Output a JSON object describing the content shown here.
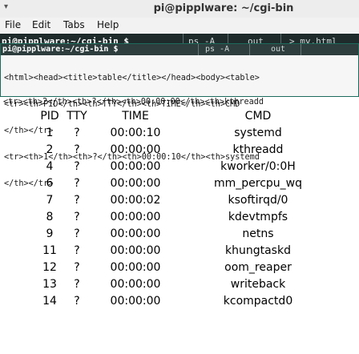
{
  "window": {
    "menu_glyph": "▾",
    "title": "pi@pipplware: ~/cgi-bin"
  },
  "menubar": {
    "file": "File",
    "edit": "Edit",
    "tabs": "Tabs",
    "help": "Help"
  },
  "back_tabbar": {
    "host": "pi@pipplware:~/cgi-bin $",
    "prompt_char": "$",
    "ps": "ps -A",
    "out": "out",
    "redirect": "> my.html"
  },
  "front_terminal": {
    "host": "pi@pipplware:~/cgi-bin $",
    "ps": "ps -A",
    "out": "out",
    "lines": [
      "<html><head><title>table</title></head><body><table>",
      "<tr><th>PID</th><th>TTY</th><th>TIME</th><th>CMD",
      "</th></tr>",
      "<tr><th>1</th><th>?</th><th>00:00:10</th><th>systemd",
      "</th></tr>",
      "<tr><th>2</th><th>?</th><th>00:00:00</th><th>kthreadd"
    ]
  },
  "table": {
    "headers": [
      "PID",
      "TTY",
      "TIME",
      "CMD"
    ],
    "rows": [
      [
        "1",
        "?",
        "00:00:10",
        "systemd"
      ],
      [
        "2",
        "?",
        "00:00:00",
        "kthreadd"
      ],
      [
        "4",
        "?",
        "00:00:00",
        "kworker/0:0H"
      ],
      [
        "6",
        "?",
        "00:00:00",
        "mm_percpu_wq"
      ],
      [
        "7",
        "?",
        "00:00:02",
        "ksoftirqd/0"
      ],
      [
        "8",
        "?",
        "00:00:00",
        "kdevtmpfs"
      ],
      [
        "9",
        "?",
        "00:00:00",
        "netns"
      ],
      [
        "11",
        "?",
        "00:00:00",
        "khungtaskd"
      ],
      [
        "12",
        "?",
        "00:00:00",
        "oom_reaper"
      ],
      [
        "13",
        "?",
        "00:00:00",
        "writeback"
      ],
      [
        "14",
        "?",
        "00:00:00",
        "kcompactd0"
      ]
    ]
  }
}
